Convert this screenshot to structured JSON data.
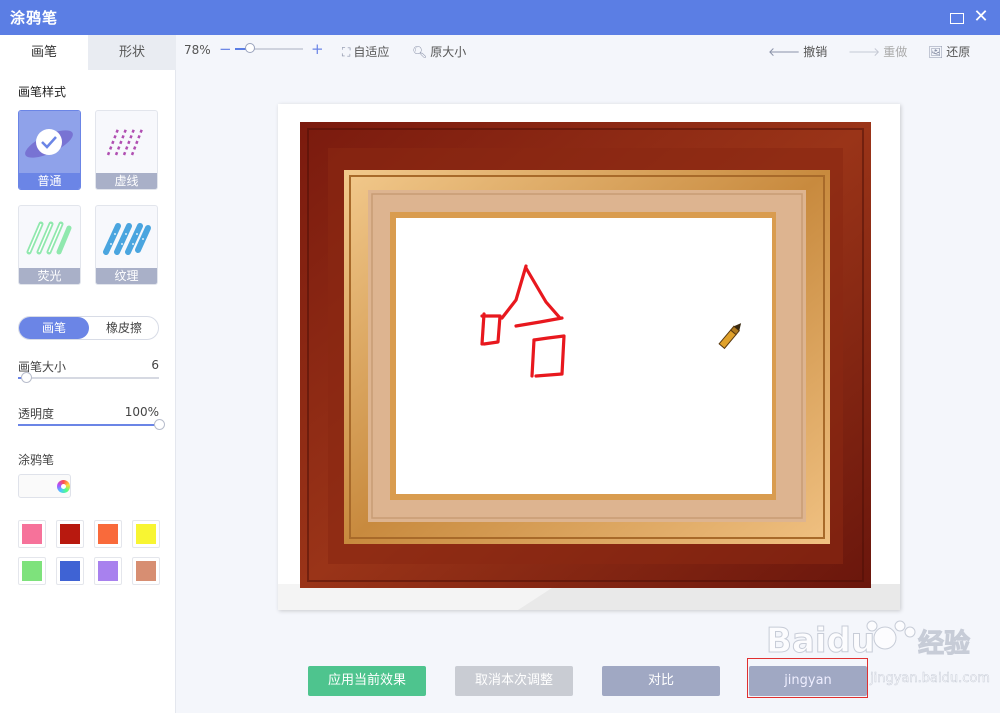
{
  "window": {
    "title": "涂鸦笔"
  },
  "panel": {
    "tabs": [
      "画笔",
      "形状"
    ],
    "style_title": "画笔样式",
    "styles": [
      {
        "label": "普通",
        "selected": true
      },
      {
        "label": "虚线",
        "selected": false
      },
      {
        "label": "荧光",
        "selected": false
      },
      {
        "label": "纹理",
        "selected": false
      }
    ],
    "mode": {
      "brush": "画笔",
      "eraser": "橡皮擦"
    },
    "size": {
      "label": "画笔大小",
      "value": "6",
      "level": 0.06
    },
    "opacity": {
      "label": "透明度",
      "value": "100%",
      "level": 1.0
    },
    "color_title": "涂鸦笔",
    "swatches": [
      "#f6729a",
      "#b8190f",
      "#f96a3b",
      "#f8f532",
      "#7ee27c",
      "#3f63d4",
      "#a881ee",
      "#d78e72"
    ]
  },
  "toolbar": {
    "zoom": "78%",
    "zoom_level": 0.22,
    "fit": "自适应",
    "original": "原大小",
    "undo": "撤销",
    "redo": "重做",
    "restore": "还原"
  },
  "canvas": {
    "drawn_text": "哈"
  },
  "actions": {
    "apply": "应用当前效果",
    "cancel": "取消本次调整",
    "compare": "对比",
    "save": "jingyan"
  },
  "watermark": {
    "brand": "Baidu",
    "cn": "经验",
    "url": "jingyan.baidu.com"
  },
  "colors": {
    "titlebar": "#5b7ee4",
    "accent": "#6b85e6",
    "apply": "#4ec48e",
    "stroke": "#e8181e"
  }
}
